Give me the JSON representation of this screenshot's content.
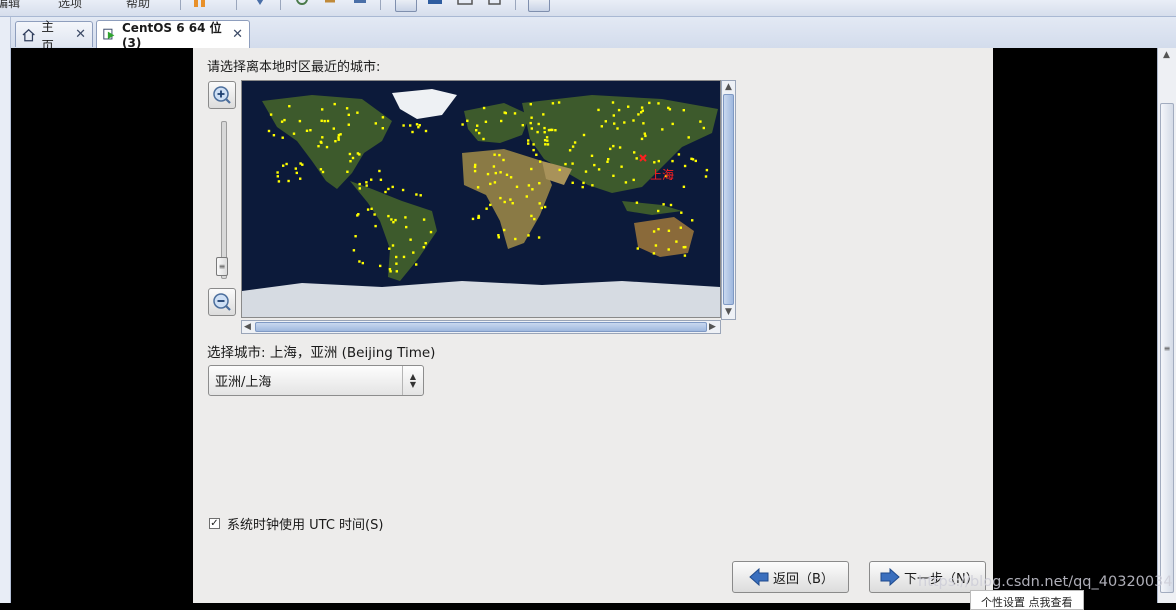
{
  "tabs": [
    {
      "label": "主页",
      "icon": "home-icon",
      "active": false
    },
    {
      "label": "CentOS 6 64 位 (3)",
      "icon": "vm-running-icon",
      "active": true
    }
  ],
  "toolbar": {
    "fragments": [
      "编辑",
      "选项",
      "帮助"
    ]
  },
  "installer": {
    "prompt": "请选择离本地时区最近的城市:",
    "map": {
      "marker_label": "上海"
    },
    "selected_city_line": "选择城市: 上海，亚洲 (Beijing Time)",
    "timezone_select": {
      "value": "亚洲/上海"
    },
    "utc_checkbox": {
      "label": "系统时钟使用 UTC 时间(S)",
      "checked": true
    },
    "back_button": "返回（B）",
    "next_button": "下一步（N）"
  },
  "watermark": "https://blog.csdn.net/qq_40320034",
  "popup": "个性设置   点我查看",
  "colors": {
    "map_ocean": "#0c1a3a",
    "city_dot": "#ffff00",
    "marker": "#ff2020",
    "tab_border": "#8e9ebd"
  }
}
